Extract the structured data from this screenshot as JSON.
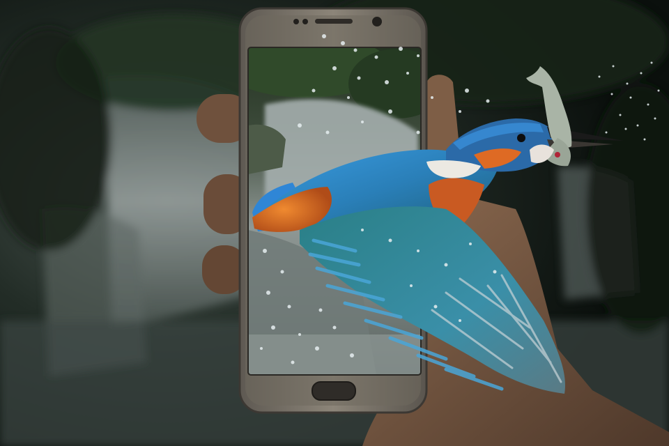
{
  "scene": {
    "subject": "kingfisher-bursting-from-smartphone",
    "elements": [
      "waterfall-background",
      "hand",
      "smartphone",
      "phone-screen-waterfall",
      "kingfisher",
      "fish",
      "water-droplets"
    ]
  },
  "colors": {
    "background_dark": "#0d120f",
    "foliage": "#1c2a1d",
    "waterfall_mist": "#8d9896",
    "phone_body": "#7a746a",
    "phone_bezel": "#4a4640",
    "skin": "#7a5a43",
    "bird_blue": "#2f7fd0",
    "bird_teal": "#2f8a8c",
    "bird_orange": "#e0782a",
    "bird_white": "#e8e6e0",
    "fish_silver": "#a8b3a4"
  }
}
